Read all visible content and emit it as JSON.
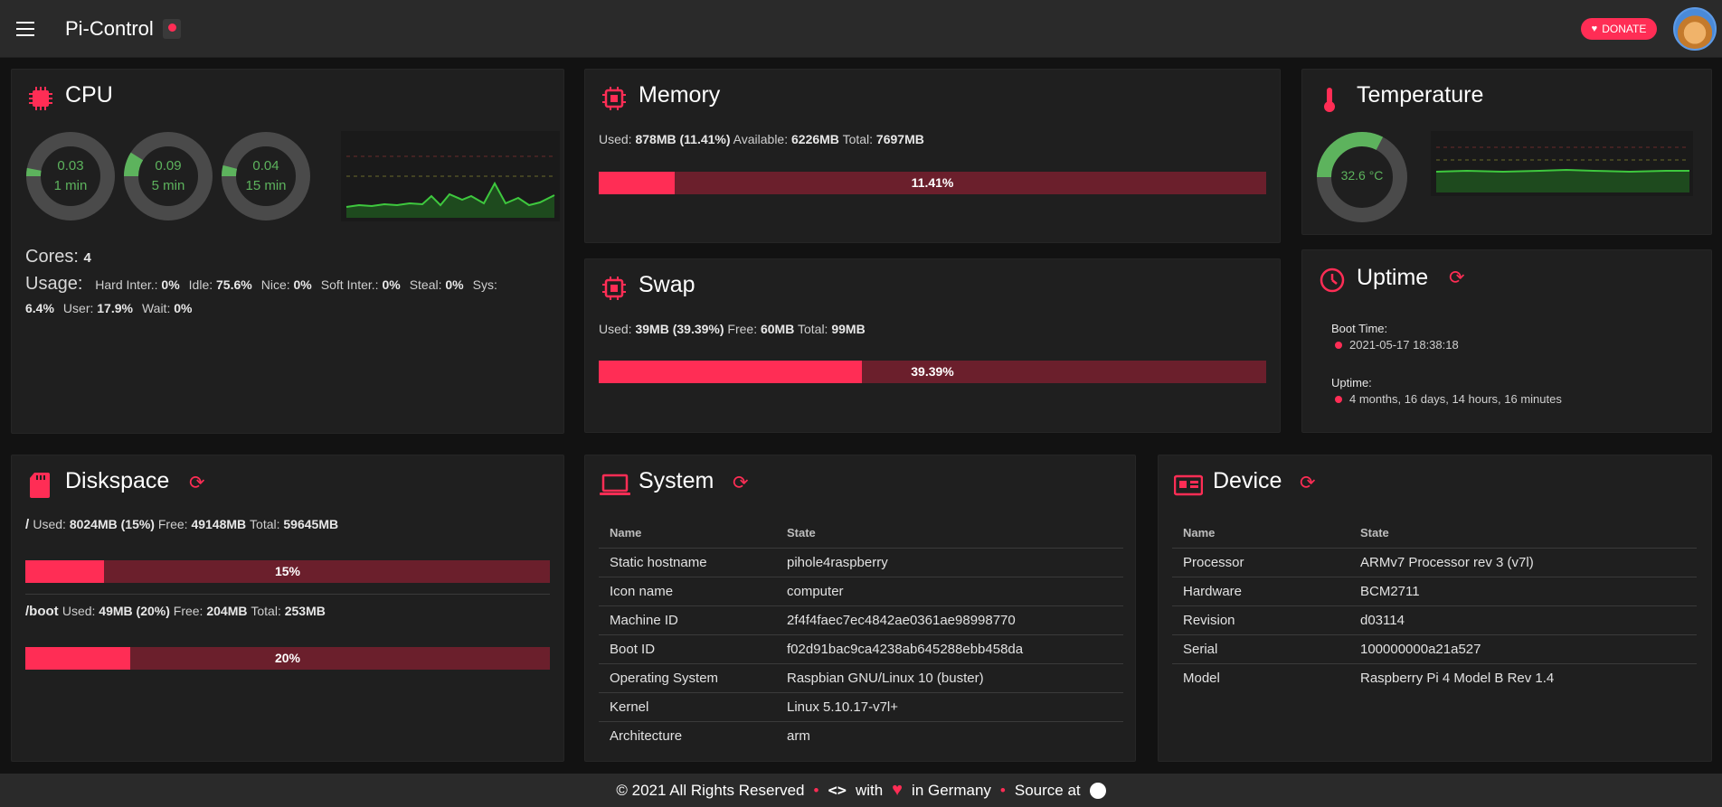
{
  "header": {
    "title": "Pi-Control",
    "donate_label": "DONATE"
  },
  "colors": {
    "accent": "#ff2d55",
    "accent_dark": "#6b1f2c",
    "ok_green": "#5db35d",
    "card_bg": "#1f1f1f",
    "page_bg": "#121212"
  },
  "cpu": {
    "title": "CPU",
    "loads": [
      {
        "value": "0.03",
        "label": "1 min",
        "fraction": 0.03
      },
      {
        "value": "0.09",
        "label": "5 min",
        "fraction": 0.09
      },
      {
        "value": "0.04",
        "label": "15 min",
        "fraction": 0.04
      }
    ],
    "cores_label": "Cores:",
    "cores_value": "4",
    "usage_label": "Usage:",
    "usage": [
      {
        "label": "Hard Inter.:",
        "value": "0%"
      },
      {
        "label": "Idle:",
        "value": "75.6%"
      },
      {
        "label": "Nice:",
        "value": "0%"
      },
      {
        "label": "Soft Inter.:",
        "value": "0%"
      },
      {
        "label": "Steal:",
        "value": "0%"
      },
      {
        "label": "Sys:",
        "value": "6.4%"
      },
      {
        "label": "User:",
        "value": "17.9%"
      },
      {
        "label": "Wait:",
        "value": "0%"
      }
    ]
  },
  "memory": {
    "title": "Memory",
    "used_label": "Used:",
    "used": "878MB (11.41%)",
    "available_label": "Available:",
    "available": "6226MB",
    "total_label": "Total:",
    "total": "7697MB",
    "percent_label": "11.41%",
    "percent": 11.41
  },
  "swap": {
    "title": "Swap",
    "used_label": "Used:",
    "used": "39MB (39.39%)",
    "free_label": "Free:",
    "free": "60MB",
    "total_label": "Total:",
    "total": "99MB",
    "percent_label": "39.39%",
    "percent": 39.39
  },
  "temperature": {
    "title": "Temperature",
    "value": "32.6 °C",
    "fraction": 0.326
  },
  "uptime": {
    "title": "Uptime",
    "boot_time_label": "Boot Time:",
    "boot_time": "2021-05-17 18:38:18",
    "uptime_label": "Uptime:",
    "uptime": "4 months, 16 days, 14 hours, 16 minutes"
  },
  "diskspace": {
    "title": "Diskspace",
    "disks": [
      {
        "mount": "/",
        "used_label": "Used:",
        "used": "8024MB (15%)",
        "free_label": "Free:",
        "free": "49148MB",
        "total_label": "Total:",
        "total": "59645MB",
        "percent_label": "15%",
        "percent": 15
      },
      {
        "mount": "/boot",
        "used_label": "Used:",
        "used": "49MB (20%)",
        "free_label": "Free:",
        "free": "204MB",
        "total_label": "Total:",
        "total": "253MB",
        "percent_label": "20%",
        "percent": 20
      }
    ]
  },
  "system": {
    "title": "System",
    "headers": [
      "Name",
      "State"
    ],
    "rows": [
      [
        "Static hostname",
        "pihole4raspberry"
      ],
      [
        "Icon name",
        "computer"
      ],
      [
        "Machine ID",
        "2f4f4faec7ec4842ae0361ae98998770"
      ],
      [
        "Boot ID",
        "f02d91bac9ca4238ab645288ebb458da"
      ],
      [
        "Operating System",
        "Raspbian GNU/Linux 10 (buster)"
      ],
      [
        "Kernel",
        "Linux 5.10.17-v7l+"
      ],
      [
        "Architecture",
        "arm"
      ]
    ]
  },
  "device": {
    "title": "Device",
    "headers": [
      "Name",
      "State"
    ],
    "rows": [
      [
        "Processor",
        "ARMv7 Processor rev 3 (v7l)"
      ],
      [
        "Hardware",
        "BCM2711"
      ],
      [
        "Revision",
        "d03114"
      ],
      [
        "Serial",
        "100000000a21a527"
      ],
      [
        "Model",
        "Raspberry Pi 4 Model B Rev 1.4"
      ]
    ]
  },
  "footer": {
    "copyright": "© 2021 All Rights Reserved",
    "with": "with",
    "in_germany": "in Germany",
    "source": "Source at"
  }
}
